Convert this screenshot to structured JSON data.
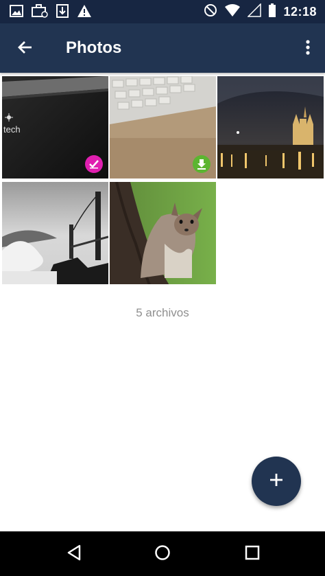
{
  "status_bar": {
    "time": "12:18",
    "left_icons": [
      "gallery-icon",
      "briefcase-icon",
      "download-icon",
      "warning-icon"
    ],
    "right_icons": [
      "do-not-disturb-icon",
      "wifi-icon",
      "signal-icon",
      "battery-icon"
    ]
  },
  "app_bar": {
    "title": "Photos",
    "back_icon": "arrow-back-icon",
    "menu_icon": "more-vert-icon"
  },
  "photos": [
    {
      "subject": "laptop-keyboard-dark",
      "badge": "check-badge",
      "badge_color": "#e01fb0"
    },
    {
      "subject": "keyboard-on-desk",
      "badge": "download-badge",
      "badge_color": "#5cb531"
    },
    {
      "subject": "cathedral-night",
      "badge": null
    },
    {
      "subject": "golden-gate-bridge",
      "badge": null
    },
    {
      "subject": "squirrel-on-tree",
      "badge": null
    }
  ],
  "file_count_text": "5 archivos",
  "fab": {
    "icon": "add-icon",
    "color": "#213451"
  },
  "nav_bar": {
    "icons": [
      "back-triangle-icon",
      "home-circle-icon",
      "recents-square-icon"
    ]
  },
  "colors": {
    "status_bar": "#172642",
    "app_bar": "#213451",
    "count_text": "#8f8f8f"
  }
}
